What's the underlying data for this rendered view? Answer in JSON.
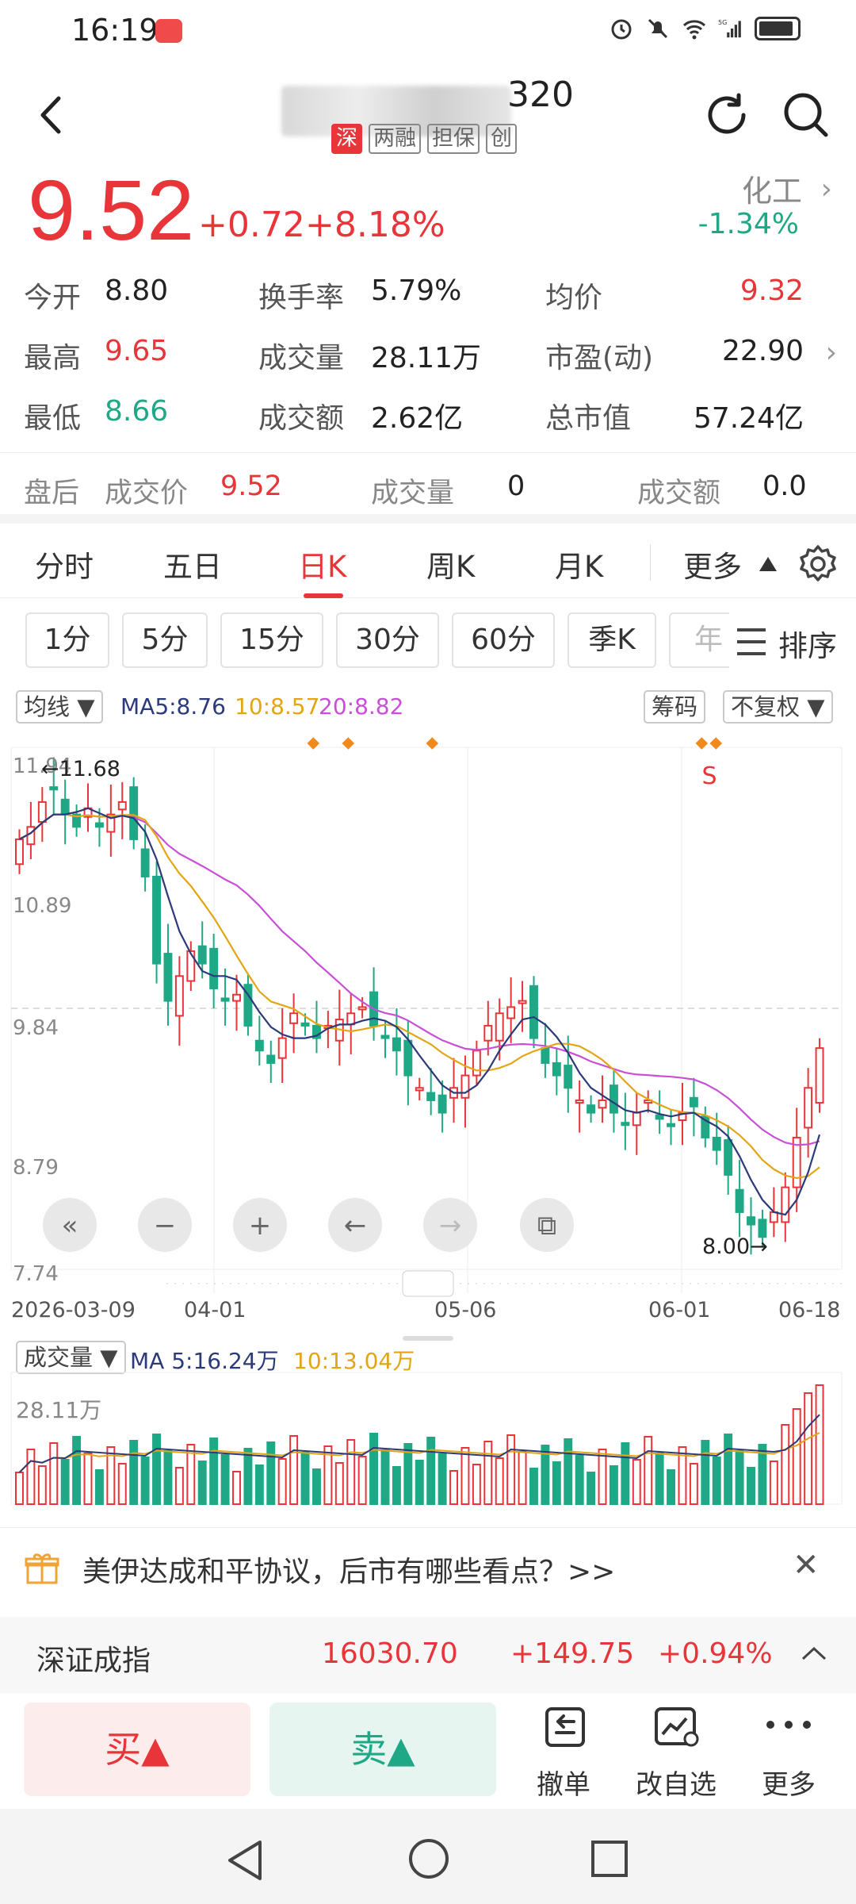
{
  "status_bar": {
    "time": "16:19",
    "network": "5G"
  },
  "header": {
    "stock_code": "320",
    "badges": [
      "深",
      "两融",
      "担保",
      "创"
    ]
  },
  "quote": {
    "price": "9.52",
    "change": "+0.72",
    "change_pct": "+8.18%",
    "sector_name": "化工",
    "sector_change": "-1.34%"
  },
  "stats": {
    "open_label": "今开",
    "open": "8.80",
    "high_label": "最高",
    "high": "9.65",
    "low_label": "最低",
    "low": "8.66",
    "turnover_label": "换手率",
    "turnover": "5.79%",
    "volume_label": "成交量",
    "volume": "28.11万",
    "amount_label": "成交额",
    "amount": "2.62亿",
    "avg_label": "均价",
    "avg": "9.32",
    "pe_label": "市盈(动)",
    "pe": "22.90",
    "mktcap_label": "总市值",
    "mktcap": "57.24亿"
  },
  "after_hours": {
    "label": "盘后",
    "price_label": "成交价",
    "price": "9.52",
    "volume_label": "成交量",
    "volume": "0",
    "amount_label": "成交额",
    "amount": "0.0"
  },
  "period_tabs": [
    "分时",
    "五日",
    "日K",
    "周K",
    "月K",
    "更多"
  ],
  "active_period": "日K",
  "intervals": [
    "1分",
    "5分",
    "15分",
    "30分",
    "60分",
    "季K",
    "年"
  ],
  "sort_label": "排序",
  "ma_row": {
    "selector": "均线 ▼",
    "ma5": "MA5:8.76",
    "ma10": "10:8.57",
    "ma20": "20:8.82",
    "chips_button": "筹码",
    "adjust_button": "不复权 ▼"
  },
  "kchart": {
    "y_ticks": [
      "11.94",
      "10.89",
      "9.84",
      "8.79",
      "7.74"
    ],
    "x_labels": [
      "2026-03-09",
      "04-01",
      "05-06",
      "06-01",
      "06-18"
    ],
    "max_marker": "←11.68",
    "min_marker": "8.00→",
    "signal_label": "S",
    "colors": {
      "up": "#e8353a",
      "down": "#1fa886",
      "ma5": "#2d3a7a",
      "ma10": "#e2a514",
      "ma20": "#c84fd6"
    }
  },
  "volume": {
    "selector": "成交量 ▼",
    "ma5": "MA 5:16.24万",
    "ma10": "10:13.04万",
    "max_label": "28.11万"
  },
  "chart_data": {
    "type": "candlestick",
    "ylim": [
      7.74,
      11.94
    ],
    "max_price": 11.68,
    "min_price": 8.0,
    "last_close": 9.52,
    "x_labels": [
      "2026-03-09",
      "04-01",
      "05-06",
      "06-01",
      "06-18"
    ],
    "closes": [
      11.2,
      11.3,
      11.5,
      11.6,
      11.4,
      11.3,
      11.45,
      11.3,
      11.4,
      11.5,
      11.2,
      10.9,
      10.2,
      9.9,
      10.1,
      10.3,
      10.2,
      10.0,
      9.9,
      9.95,
      9.7,
      9.5,
      9.4,
      9.6,
      9.8,
      9.7,
      9.6,
      9.7,
      9.75,
      9.8,
      9.85,
      9.7,
      9.6,
      9.5,
      9.3,
      9.2,
      9.1,
      9.0,
      9.2,
      9.3,
      9.5,
      9.7,
      9.8,
      9.85,
      9.9,
      9.6,
      9.4,
      9.3,
      9.2,
      9.1,
      9.0,
      9.1,
      9.0,
      8.9,
      9.0,
      9.1,
      8.95,
      8.9,
      9.0,
      9.05,
      8.8,
      8.7,
      8.5,
      8.2,
      8.1,
      8.0,
      8.2,
      8.4,
      8.8,
      9.2,
      9.52
    ],
    "volume_max": "28.11万",
    "volume_ma5": "16.24万",
    "volume_ma10": "13.04万"
  },
  "news": {
    "text": "美伊达成和平协议，后市有哪些看点？>>"
  },
  "index_bar": {
    "name": "深证成指",
    "value": "16030.70",
    "change": "+149.75",
    "change_pct": "+0.94%"
  },
  "trade": {
    "buy": "买▲",
    "sell": "卖▲",
    "tools": [
      "撤单",
      "改自选",
      "更多"
    ]
  }
}
